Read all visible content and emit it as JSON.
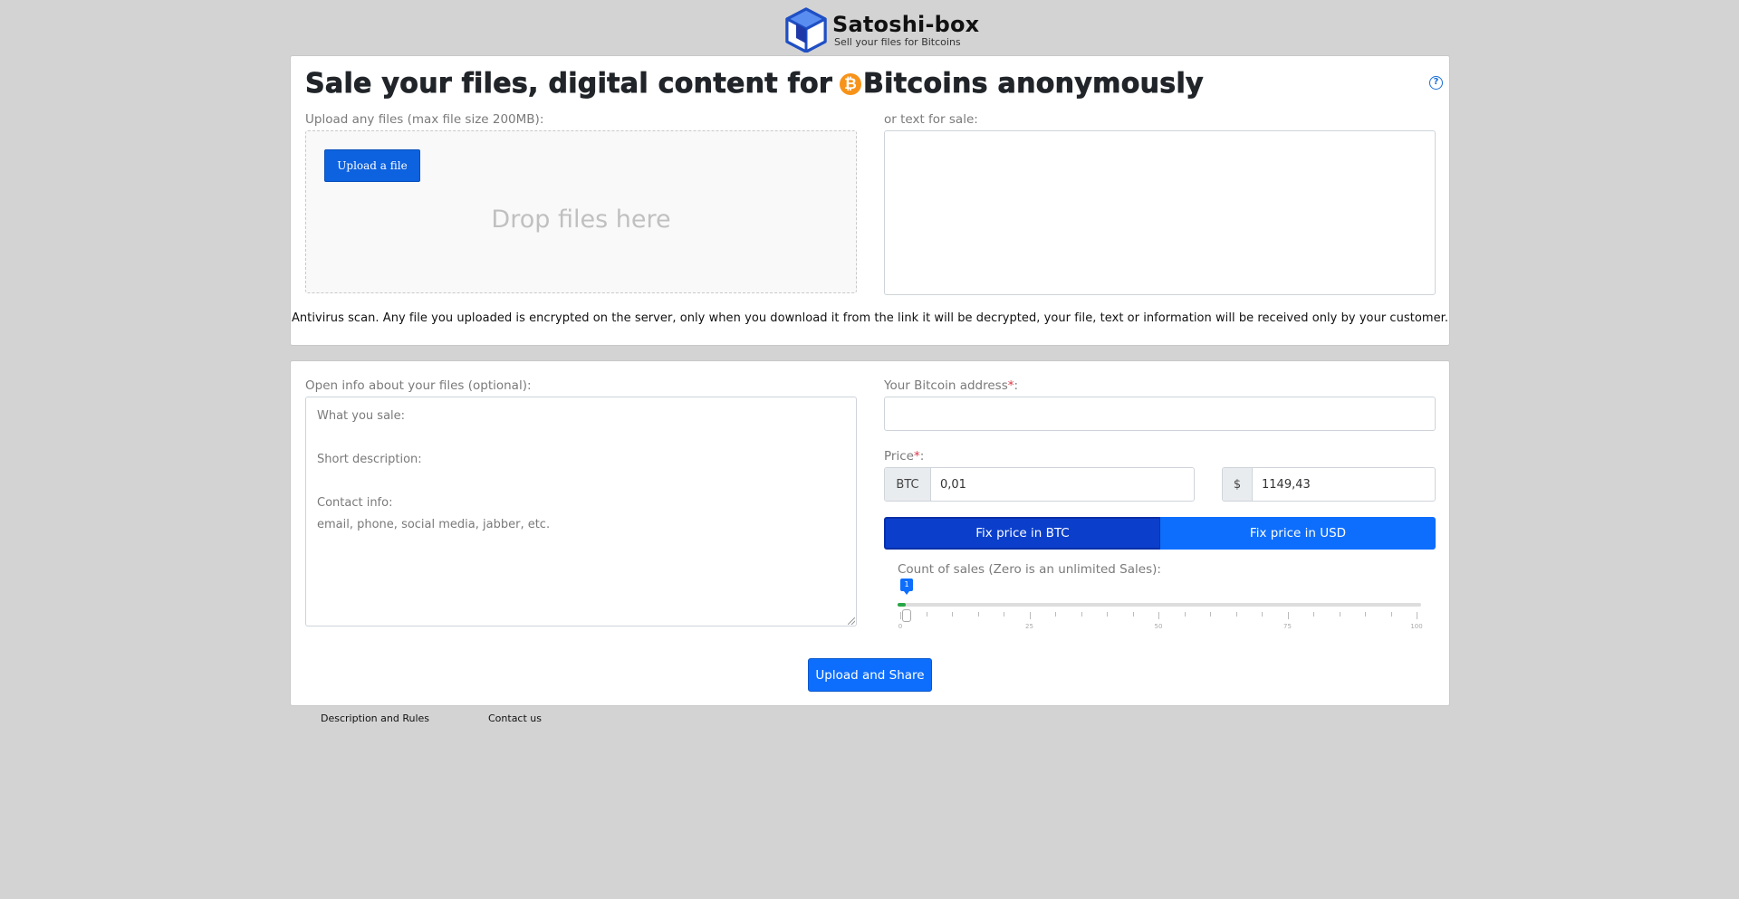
{
  "brand": {
    "name": "Satoshi-box",
    "tagline": "Sell your files for Bitcoins"
  },
  "upload_card": {
    "title_prefix": "Sale your files, digital content for",
    "title_suffix": "Bitcoins anonymously",
    "btc_symbol": "₿",
    "help_glyph": "?",
    "files_label": "Upload any files (max file size 200MB):",
    "upload_button": "Upload a file",
    "drop_text": "Drop files here",
    "text_label": "or text for sale:",
    "text_value": "",
    "antivirus_note": "Antivirus scan. Any file you uploaded is encrypted on the server, only when you download it from the link it will be decrypted, your file, text or information will be received only by your customer."
  },
  "details_card": {
    "info_label": "Open info about your files (optional):",
    "info_lines": {
      "what": "What you sale:",
      "short": "Short description:",
      "contact": "Contact info:",
      "contact_hint": "email, phone, social media, jabber, etc."
    },
    "address_label": "Your Bitcoin address",
    "required_mark": "*",
    "colon": ":",
    "address_value": "",
    "price_label": "Price",
    "btc_addon": "BTC",
    "btc_value": "0,01",
    "usd_addon": "$",
    "usd_value": "1149,43",
    "fix_btc": "Fix price in BTC",
    "fix_usd": "Fix price in USD",
    "sales_label": "Count of sales (Zero is an unlimited Sales):",
    "slider": {
      "value": "1",
      "min": 0,
      "max": 100,
      "tick_labels": [
        "0",
        "25",
        "50",
        "75",
        "100"
      ]
    },
    "share_button": "Upload and Share"
  },
  "footer": {
    "rules": "Description and Rules",
    "contact": "Contact us"
  },
  "colors": {
    "background": "#d3d3d3",
    "primary": "#0d6efd",
    "primary_active": "#0b3fcb",
    "bitcoin": "#f7931a",
    "slider_fill": "#28a745"
  }
}
